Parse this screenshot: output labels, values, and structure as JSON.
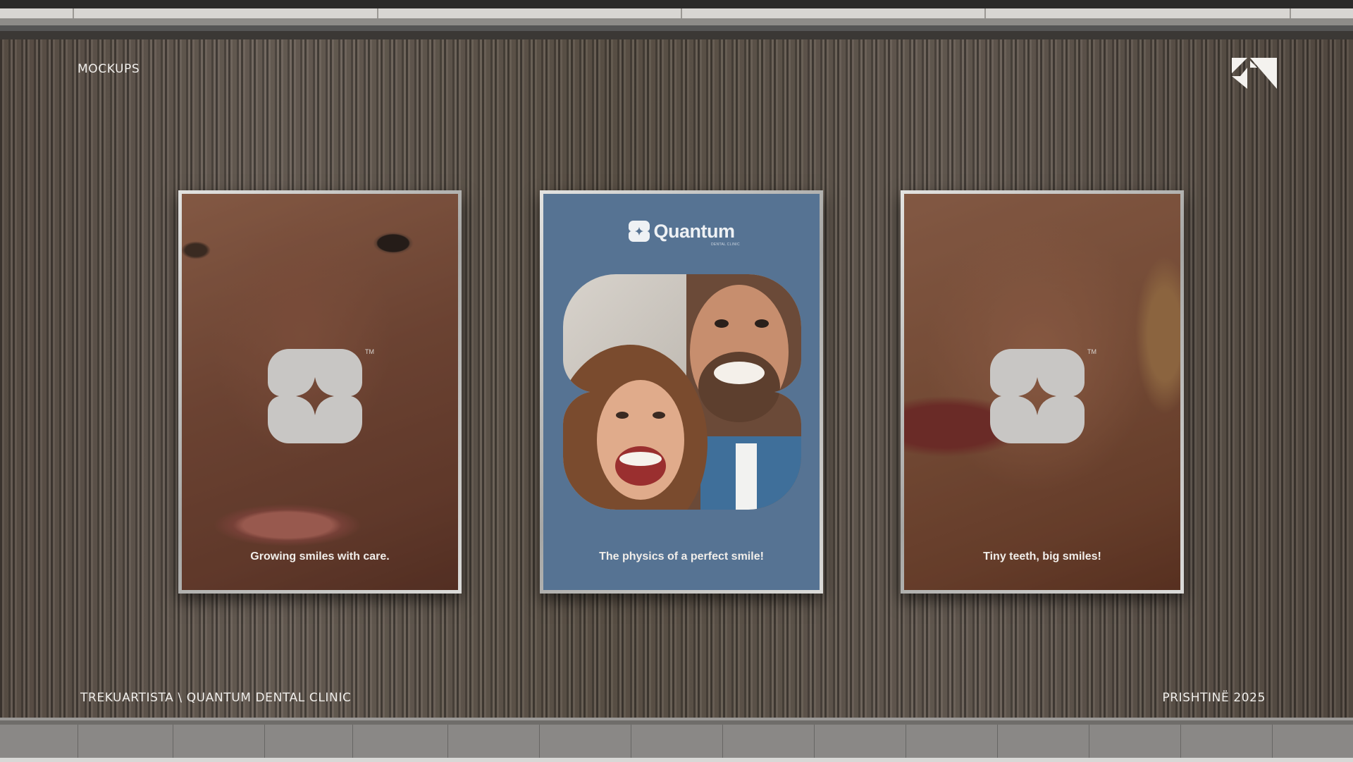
{
  "header": {
    "label": "MOCKUPS"
  },
  "footer": {
    "left": "TREKUARTISTA \\ QUANTUM DENTAL CLINIC",
    "right": "PRISHTINË 2025"
  },
  "posters": [
    {
      "tagline": "Growing smiles with care.",
      "tm": "TM"
    },
    {
      "brand": "Quantum",
      "brand_sub": "DENTAL CLINIC",
      "tagline": "The physics of a perfect smile!"
    },
    {
      "tagline": "Tiny teeth, big smiles!",
      "tm": "TM"
    }
  ],
  "colors": {
    "poster_blue": "#567393",
    "mark_gray": "#c8c6c4",
    "wall": "#5e5449"
  },
  "icons": [
    "brand-mark-icon",
    "quantum-symbol-icon"
  ]
}
